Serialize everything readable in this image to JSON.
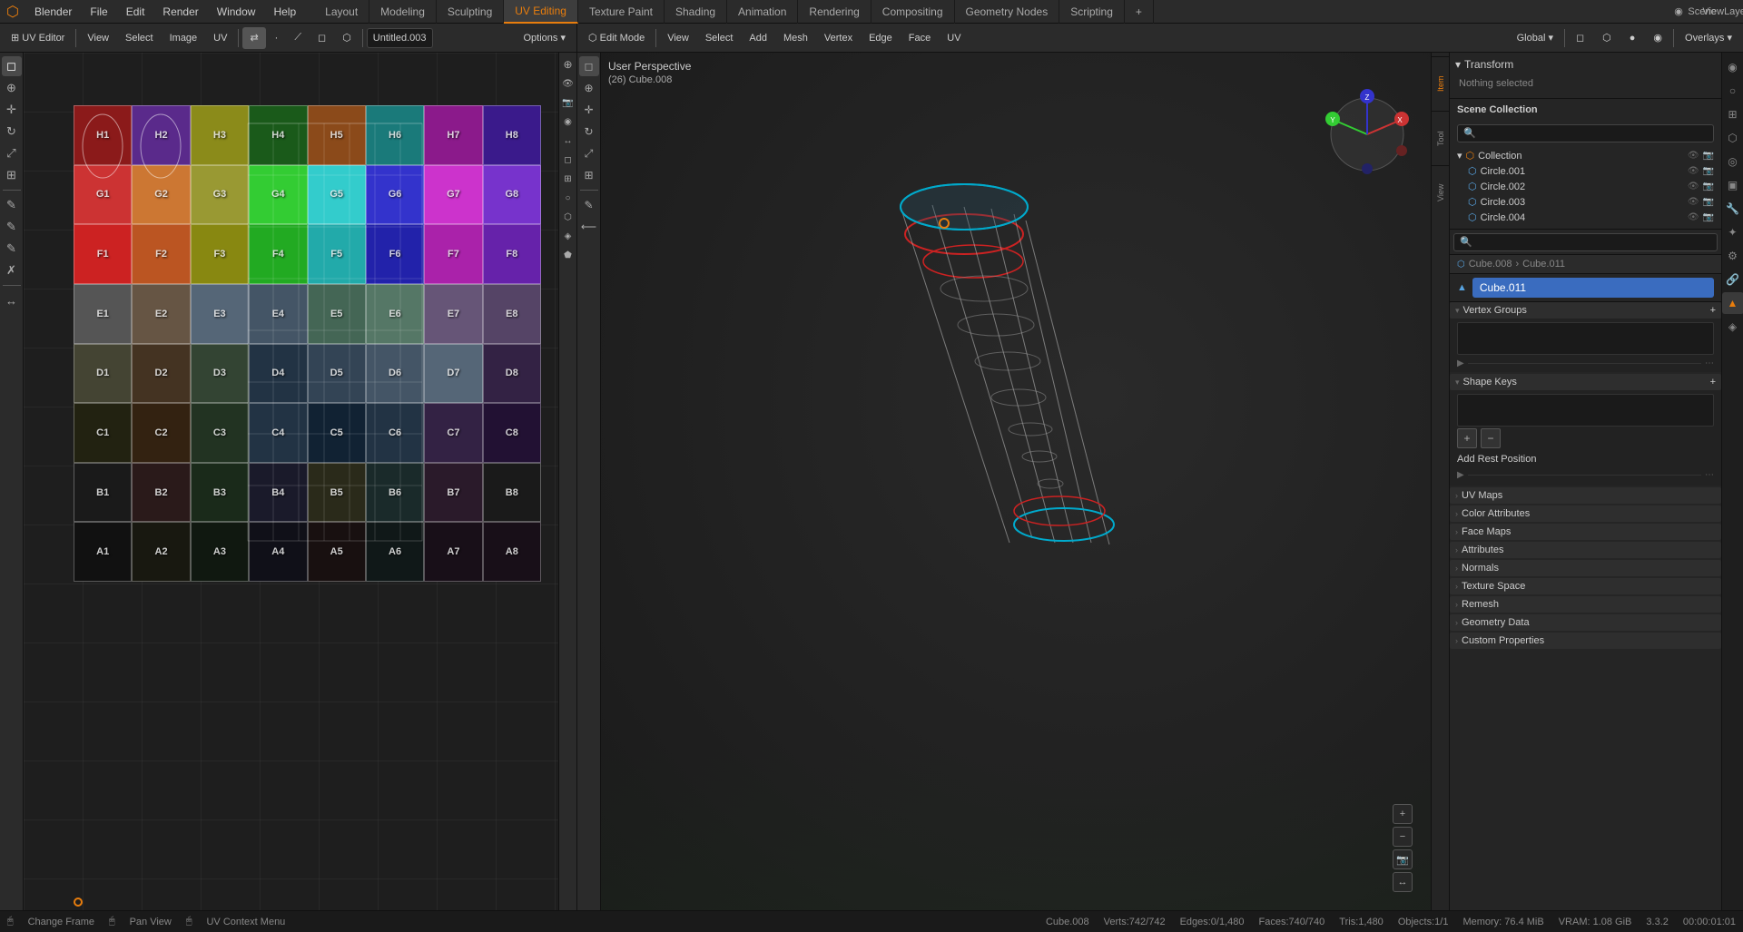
{
  "app": {
    "title": "Blender",
    "version": "3.3.2"
  },
  "top_menu": {
    "logo": "⬡",
    "items": [
      "Blender",
      "File",
      "Edit",
      "Render",
      "Window",
      "Help"
    ],
    "workspace_tabs": [
      {
        "label": "Layout",
        "active": false
      },
      {
        "label": "Modeling",
        "active": false
      },
      {
        "label": "Sculpting",
        "active": false
      },
      {
        "label": "UV Editing",
        "active": true
      },
      {
        "label": "Texture Paint",
        "active": false
      },
      {
        "label": "Shading",
        "active": false
      },
      {
        "label": "Animation",
        "active": false
      },
      {
        "label": "Rendering",
        "active": false
      },
      {
        "label": "Compositing",
        "active": false
      },
      {
        "label": "Geometry Nodes",
        "active": false
      },
      {
        "label": "Scripting",
        "active": false
      },
      {
        "label": "+",
        "active": false
      }
    ],
    "right": {
      "scene": "Scene",
      "view_layer": "ViewLayer"
    }
  },
  "uv_editor": {
    "header": {
      "mode_btn": "⊞",
      "view_label": "View",
      "select_label": "Select",
      "image_label": "Image",
      "uv_label": "UV",
      "sync_btn": "⇄",
      "filename": "Untitled.003",
      "overlay_btn": "Options ▾"
    },
    "grid": {
      "cells": [
        {
          "row": 8,
          "col": 1,
          "label": "H1",
          "color": "#8b1a1a"
        },
        {
          "row": 8,
          "col": 2,
          "label": "H2",
          "color": "#5a2a8b"
        },
        {
          "row": 8,
          "col": 3,
          "label": "H3",
          "color": "#8b8b1a"
        },
        {
          "row": 8,
          "col": 4,
          "label": "H4",
          "color": "#1a5a1a"
        },
        {
          "row": 8,
          "col": 5,
          "label": "H5",
          "color": "#8b4a1a"
        },
        {
          "row": 8,
          "col": 6,
          "label": "H6",
          "color": "#1a7a7a"
        },
        {
          "row": 8,
          "col": 7,
          "label": "H7",
          "color": "#8b1a8b"
        },
        {
          "row": 8,
          "col": 8,
          "label": "H8",
          "color": "#3a1a8b"
        },
        {
          "row": 7,
          "col": 1,
          "label": "G1",
          "color": "#cc3333"
        },
        {
          "row": 7,
          "col": 2,
          "label": "G2",
          "color": "#cc7733"
        },
        {
          "row": 7,
          "col": 3,
          "label": "G3",
          "color": "#999933"
        },
        {
          "row": 7,
          "col": 4,
          "label": "G4",
          "color": "#33cc33"
        },
        {
          "row": 7,
          "col": 5,
          "label": "G5",
          "color": "#33cccc"
        },
        {
          "row": 7,
          "col": 6,
          "label": "G6",
          "color": "#3333cc"
        },
        {
          "row": 7,
          "col": 7,
          "label": "G7",
          "color": "#cc33cc"
        },
        {
          "row": 7,
          "col": 8,
          "label": "G8",
          "color": "#7733cc"
        },
        {
          "row": 6,
          "col": 1,
          "label": "F1",
          "color": "#cc2222"
        },
        {
          "row": 6,
          "col": 2,
          "label": "F2",
          "color": "#bb5522"
        },
        {
          "row": 6,
          "col": 3,
          "label": "F3",
          "color": "#888811"
        },
        {
          "row": 6,
          "col": 4,
          "label": "F4",
          "color": "#22aa22"
        },
        {
          "row": 6,
          "col": 5,
          "label": "F5",
          "color": "#22aaaa"
        },
        {
          "row": 6,
          "col": 6,
          "label": "F6",
          "color": "#2222aa"
        },
        {
          "row": 6,
          "col": 7,
          "label": "F7",
          "color": "#aa22aa"
        },
        {
          "row": 6,
          "col": 8,
          "label": "F8",
          "color": "#6622aa"
        },
        {
          "row": 5,
          "col": 1,
          "label": "E1",
          "color": "#777777"
        },
        {
          "row": 5,
          "col": 2,
          "label": "E2",
          "color": "#888866"
        },
        {
          "row": 5,
          "col": 3,
          "label": "E3",
          "color": "#666688"
        },
        {
          "row": 5,
          "col": 4,
          "label": "E4",
          "color": "#556677"
        },
        {
          "row": 5,
          "col": 5,
          "label": "E5",
          "color": "#446655"
        },
        {
          "row": 5,
          "col": 6,
          "label": "E6",
          "color": "#557766"
        },
        {
          "row": 5,
          "col": 7,
          "label": "E7",
          "color": "#665577"
        },
        {
          "row": 5,
          "col": 8,
          "label": "E8",
          "color": "#554466"
        },
        {
          "row": 4,
          "col": 1,
          "label": "D1",
          "color": "#555544"
        },
        {
          "row": 4,
          "col": 2,
          "label": "D2",
          "color": "#554433"
        },
        {
          "row": 4,
          "col": 3,
          "label": "D3",
          "color": "#445544"
        },
        {
          "row": 4,
          "col": 4,
          "label": "D4",
          "color": "#334455"
        },
        {
          "row": 4,
          "col": 5,
          "label": "D5",
          "color": "#445566"
        },
        {
          "row": 4,
          "col": 6,
          "label": "D6",
          "color": "#556677"
        },
        {
          "row": 4,
          "col": 7,
          "label": "D7",
          "color": "#667788"
        },
        {
          "row": 4,
          "col": 8,
          "label": "D8",
          "color": "#443355"
        },
        {
          "row": 3,
          "col": 1,
          "label": "C1",
          "color": "#333322"
        },
        {
          "row": 3,
          "col": 2,
          "label": "C2",
          "color": "#443322"
        },
        {
          "row": 3,
          "col": 3,
          "label": "C3",
          "color": "#334433"
        },
        {
          "row": 3,
          "col": 4,
          "label": "C4",
          "color": "#334455"
        },
        {
          "row": 3,
          "col": 5,
          "label": "C5",
          "color": "#223344"
        },
        {
          "row": 3,
          "col": 6,
          "label": "C6",
          "color": "#334455"
        },
        {
          "row": 3,
          "col": 7,
          "label": "C7",
          "color": "#443355"
        },
        {
          "row": 3,
          "col": 8,
          "label": "C8",
          "color": "#332244"
        },
        {
          "row": 2,
          "col": 1,
          "label": "B1",
          "color": "#2a2a2a"
        },
        {
          "row": 2,
          "col": 2,
          "label": "B2",
          "color": "#3a2a2a"
        },
        {
          "row": 2,
          "col": 3,
          "label": "B3",
          "color": "#2a3a2a"
        },
        {
          "row": 2,
          "col": 4,
          "label": "B4",
          "color": "#2a2a3a"
        },
        {
          "row": 2,
          "col": 5,
          "label": "B5",
          "color": "#3a3a2a"
        },
        {
          "row": 2,
          "col": 6,
          "label": "B6",
          "color": "#2a3a3a"
        },
        {
          "row": 2,
          "col": 7,
          "label": "B7",
          "color": "#3a2a3a"
        },
        {
          "row": 2,
          "col": 8,
          "label": "B8",
          "color": "#2a2a2a"
        },
        {
          "row": 1,
          "col": 1,
          "label": "A1",
          "color": "#1a1a1a"
        },
        {
          "row": 1,
          "col": 2,
          "label": "A2",
          "color": "#222211"
        },
        {
          "row": 1,
          "col": 3,
          "label": "A3",
          "color": "#112211"
        },
        {
          "row": 1,
          "col": 4,
          "label": "A4",
          "color": "#111122"
        },
        {
          "row": 1,
          "col": 5,
          "label": "A5",
          "color": "#221111"
        },
        {
          "row": 1,
          "col": 6,
          "label": "A6",
          "color": "#111a1a"
        },
        {
          "row": 1,
          "col": 7,
          "label": "A7",
          "color": "#1a111a"
        },
        {
          "row": 1,
          "col": 8,
          "label": "A8",
          "color": "#221122"
        }
      ]
    }
  },
  "viewport": {
    "mode": "User Perspective",
    "object": "(26) Cube.008",
    "header_buttons": [
      "View",
      "Select",
      "Add",
      "Mesh",
      "Vertex",
      "Edge",
      "Face",
      "UV"
    ],
    "transform_options": [
      "Global ▾"
    ],
    "shading_modes": [
      "◻",
      "⬡",
      "●",
      "◉"
    ],
    "overlays": "Overlays ▾",
    "gizmo": true
  },
  "transform_panel": {
    "header": "Transform",
    "nothing_selected": "Nothing selected"
  },
  "scene_collection": {
    "header": "Scene Collection",
    "items": [
      {
        "name": "Collection",
        "icon": "⬡",
        "indent": 0,
        "expanded": true
      },
      {
        "name": "Circle.001",
        "icon": "⬡",
        "indent": 1,
        "type": "mesh"
      },
      {
        "name": "Circle.002",
        "icon": "⬡",
        "indent": 1,
        "type": "mesh"
      },
      {
        "name": "Circle.003",
        "icon": "⬡",
        "indent": 1,
        "type": "mesh"
      },
      {
        "name": "Circle.004",
        "icon": "⬡",
        "indent": 1,
        "type": "mesh"
      }
    ]
  },
  "object_data_props": {
    "breadcrumb_parent": "Cube.008",
    "breadcrumb_child": "Cube.011",
    "object_name": "Cube.011",
    "sections": [
      {
        "label": "Vertex Groups",
        "expanded": true
      },
      {
        "label": "Shape Keys",
        "expanded": true
      },
      {
        "label": "UV Maps",
        "collapsed": true
      },
      {
        "label": "Color Attributes",
        "collapsed": true
      },
      {
        "label": "Face Maps",
        "collapsed": true
      },
      {
        "label": "Attributes",
        "collapsed": true
      },
      {
        "label": "Normals",
        "collapsed": true
      },
      {
        "label": "Texture Space",
        "collapsed": true
      },
      {
        "label": "Remesh",
        "collapsed": true
      },
      {
        "label": "Geometry Data",
        "collapsed": true
      },
      {
        "label": "Custom Properties",
        "collapsed": true
      }
    ]
  },
  "status_bar": {
    "left_action": "Change Frame",
    "middle_action": "Pan View",
    "right_action": "UV Context Menu",
    "object_info": "Cube.008",
    "verts": "Verts:742/742",
    "edges": "Edges:0/1,480",
    "faces": "Faces:740/740",
    "tris": "Tris:1,480",
    "objects": "Objects:1/1",
    "memory": "Memory: 76.4 MiB",
    "vram": "VRAM: 1.08 GiB",
    "version": "3.3.2",
    "time": "00:00:01:01"
  },
  "icons": {
    "select_box": "◻",
    "cursor": "⊕",
    "move": "✛",
    "rotate": "↻",
    "scale": "⤢",
    "transform": "⊞",
    "annotate": "✎",
    "measure": "⟵",
    "add_btn": "+",
    "arrow_right": "▶",
    "arrow_down": "▾",
    "arrow_up": "▴",
    "mesh_icon": "⬡",
    "eye_icon": "👁",
    "camera_icon": "📷",
    "render_icon": "◉",
    "world_icon": "○",
    "object_icon": "⬡",
    "modifier_icon": "🔧",
    "particles_icon": "✦",
    "physics_icon": "⚙",
    "constraint_icon": "🔗",
    "data_icon": "▲",
    "material_icon": "◈"
  }
}
